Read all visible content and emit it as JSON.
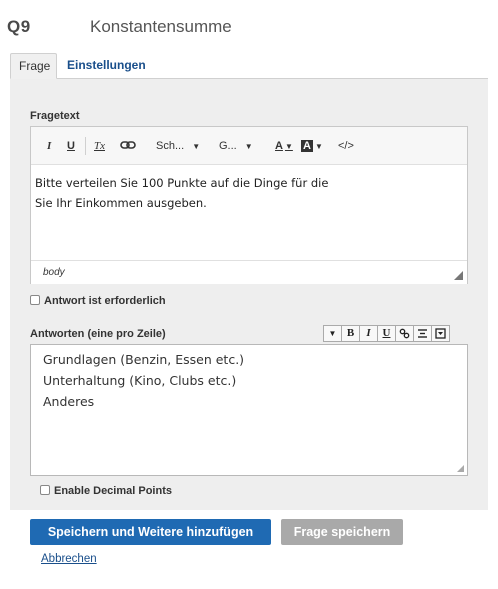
{
  "question": {
    "number": "Q9",
    "title": "Konstantensumme"
  },
  "tabs": [
    {
      "label": "Frage",
      "active": true
    },
    {
      "label": "Einstellungen",
      "active": false
    }
  ],
  "question_text": {
    "label": "Fragetext",
    "toolbar": {
      "italic": "I",
      "underline": "U",
      "clear_format": "Tx",
      "link_icon": "link-icon",
      "font_family": "Sch...",
      "font_size": "G...",
      "text_color": "A",
      "bg_color": "A",
      "source": "</>"
    },
    "content_line1": "Bitte verteilen Sie 100 Punkte auf die Dinge für die",
    "content_line2": "Sie Ihr Einkommen ausgeben.",
    "path": "body"
  },
  "required": {
    "label": "Antwort ist erforderlich",
    "checked": false
  },
  "answers": {
    "label": "Antworten (eine pro Zeile)",
    "toolbar": [
      "B",
      "I",
      "U"
    ],
    "items": [
      "Grundlagen (Benzin, Essen etc.)",
      "Unterhaltung (Kino, Clubs etc.)",
      "Anderes"
    ]
  },
  "decimal": {
    "label": "Enable Decimal Points",
    "checked": false
  },
  "actions": {
    "save_add": "Speichern und Weitere hinzufügen",
    "save": "Frage speichern",
    "cancel": "Abbrechen"
  },
  "colors": {
    "primary": "#1f6ab3",
    "disabled": "#a9a9a9",
    "link": "#1a4f8b",
    "panel": "#eeeeee"
  }
}
